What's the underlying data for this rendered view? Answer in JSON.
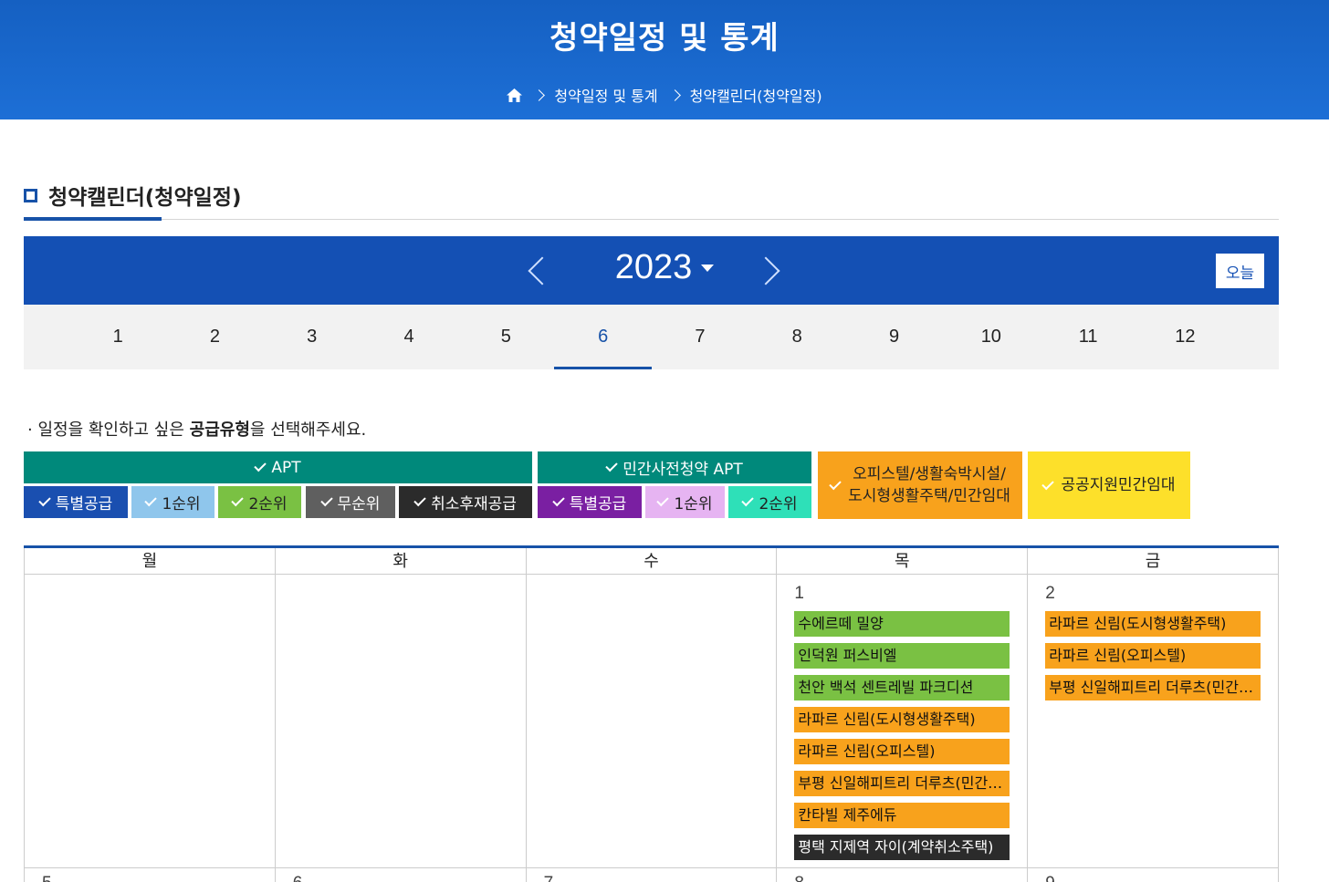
{
  "header": {
    "title": "청약일정 및 통계",
    "breadcrumb": [
      "청약일정 및 통계",
      "청약캘린더(청약일정)"
    ]
  },
  "section_title": "청약캘린더(청약일정)",
  "calendar_nav": {
    "year": "2023",
    "today_label": "오늘",
    "months": [
      "1",
      "2",
      "3",
      "4",
      "5",
      "6",
      "7",
      "8",
      "9",
      "10",
      "11",
      "12"
    ],
    "selected_month": "6"
  },
  "notice": {
    "prefix": "· 일정을 확인하고 싶은 ",
    "bold": "공급유형",
    "suffix": "을 선택해주세요."
  },
  "filters": {
    "apt": {
      "label": "APT",
      "chips": [
        "특별공급",
        "1순위",
        "2순위",
        "무순위",
        "취소후재공급"
      ]
    },
    "private": {
      "label": "민간사전청약 APT",
      "chips": [
        "특별공급",
        "1순위",
        "2순위"
      ]
    },
    "officetel": {
      "line1": "오피스텔/생활숙박시설/",
      "line2": "도시형생활주택/민간임대"
    },
    "public_rental": {
      "label": "공공지원민간임대"
    }
  },
  "colors": {
    "apt_head": "#00897b",
    "apt_special": "#1a4fb0",
    "apt_first": "#8fc6ec",
    "apt_second": "#7ac143",
    "apt_none": "#5f5f5f",
    "apt_cancel": "#2b2b2b",
    "private_head": "#00897b",
    "private_special": "#7a1fa2",
    "private_first": "#e6b4f2",
    "private_second": "#2ee0b8",
    "officetel": "#f8a21c",
    "public_rental": "#fde02a"
  },
  "weekdays": [
    "월",
    "화",
    "수",
    "목",
    "금"
  ],
  "week1": {
    "days": [
      "",
      "",
      "",
      "1",
      "2"
    ],
    "thursday_events": [
      {
        "label": "수에르떼 밀양",
        "type": "green"
      },
      {
        "label": "인덕원 퍼스비엘",
        "type": "green"
      },
      {
        "label": "천안 백석 센트레빌 파크디션",
        "type": "green"
      },
      {
        "label": "라파르 신림(도시형생활주택)",
        "type": "orange"
      },
      {
        "label": "라파르 신림(오피스텔)",
        "type": "orange"
      },
      {
        "label": "부평 신일해피트리 더루츠(민간임대)",
        "type": "orange"
      },
      {
        "label": "칸타빌 제주에듀",
        "type": "orange"
      },
      {
        "label": "평택 지제역 자이(계약취소주택)",
        "type": "dark"
      }
    ],
    "friday_events": [
      {
        "label": "라파르 신림(도시형생활주택)",
        "type": "orange"
      },
      {
        "label": "라파르 신림(오피스텔)",
        "type": "orange"
      },
      {
        "label": "부평 신일해피트리 더루츠(민간임대)",
        "type": "orange"
      }
    ]
  },
  "week2": {
    "days": [
      "5",
      "6",
      "7",
      "8",
      "9"
    ]
  }
}
